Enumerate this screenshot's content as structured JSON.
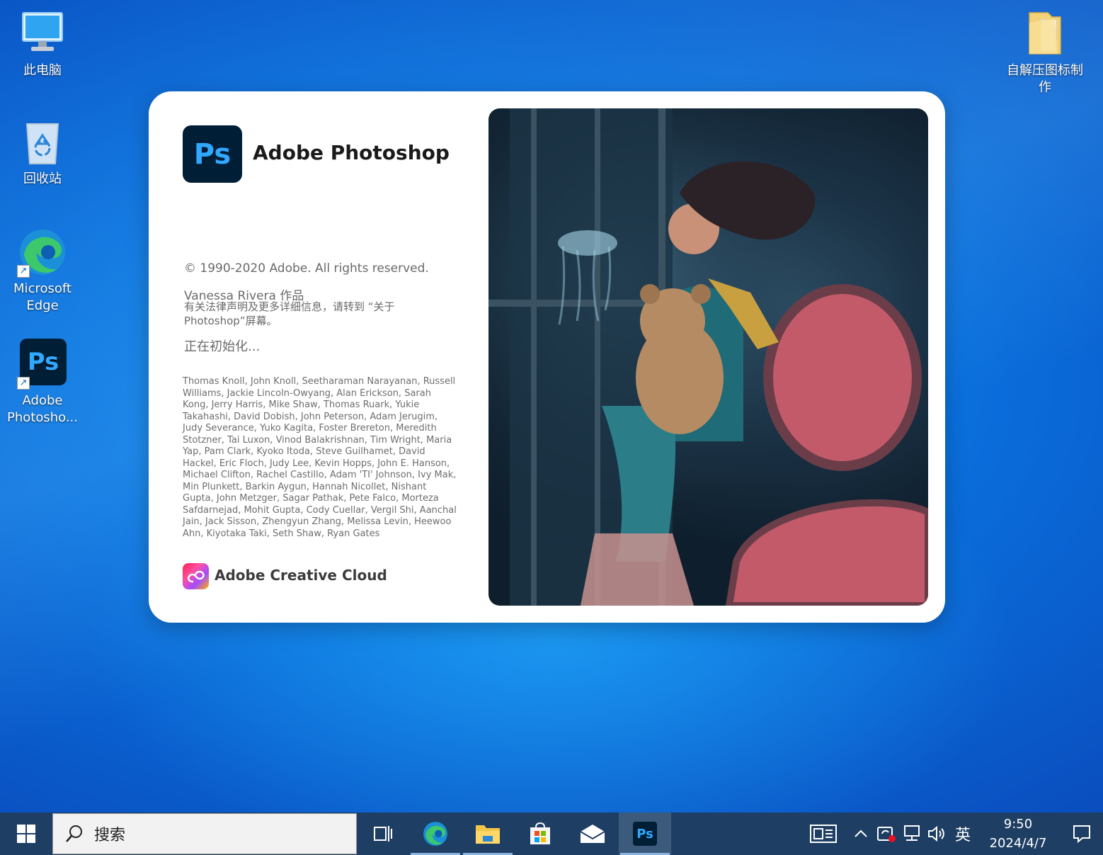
{
  "desktop": {
    "icons": [
      {
        "label": "此电脑"
      },
      {
        "label": "回收站"
      },
      {
        "label": "Microsoft Edge"
      },
      {
        "label": "Adobe Photosho..."
      },
      {
        "label": "自解压图标制作"
      }
    ]
  },
  "splash": {
    "logo_text": "Ps",
    "app_name": "Adobe Photoshop",
    "copyright": "© 1990-2020 Adobe. All rights reserved.",
    "author": "Vanessa  Rivera 作品",
    "legal": "有关法律声明及更多详细信息，请转到 “关于 Photoshop”屏幕。",
    "status": "正在初始化...",
    "credits": "Thomas Knoll, John Knoll, Seetharaman Narayanan, Russell Williams, Jackie Lincoln-Owyang, Alan Erickson, Sarah Kong, Jerry Harris, Mike Shaw, Thomas Ruark, Yukie Takahashi, David Dobish, John Peterson, Adam Jerugim, Judy Severance, Yuko Kagita, Foster Brereton, Meredith Stotzner, Tai Luxon, Vinod Balakrishnan, Tim Wright, Maria Yap, Pam Clark, Kyoko Itoda, Steve Guilhamet, David Hackel, Eric Floch, Judy Lee, Kevin Hopps, John E. Hanson, Michael Clifton, Rachel Castillo, Adam 'TI' Johnson, Ivy Mak, Min Plunkett, Barkin Aygun, Hannah Nicollet, Nishant Gupta, John Metzger, Sagar Pathak, Pete Falco, Morteza Safdarnejad, Mohit Gupta, Cody Cuellar, Vergil Shi, Aanchal Jain, Jack Sisson, Zhengyun Zhang, Melissa Levin, Heewoo Ahn, Kiyotaka Taki, Seth Shaw, Ryan Gates",
    "cc_name": "Adobe Creative Cloud"
  },
  "taskbar": {
    "search_placeholder": "搜索",
    "ps_label": "Ps",
    "ime": "英",
    "time": "9:50",
    "date": "2024/4/7"
  },
  "colors": {
    "ps_bg": "#001e36",
    "ps_text": "#31a8ff",
    "taskbar_bg": "#1e3f63"
  }
}
